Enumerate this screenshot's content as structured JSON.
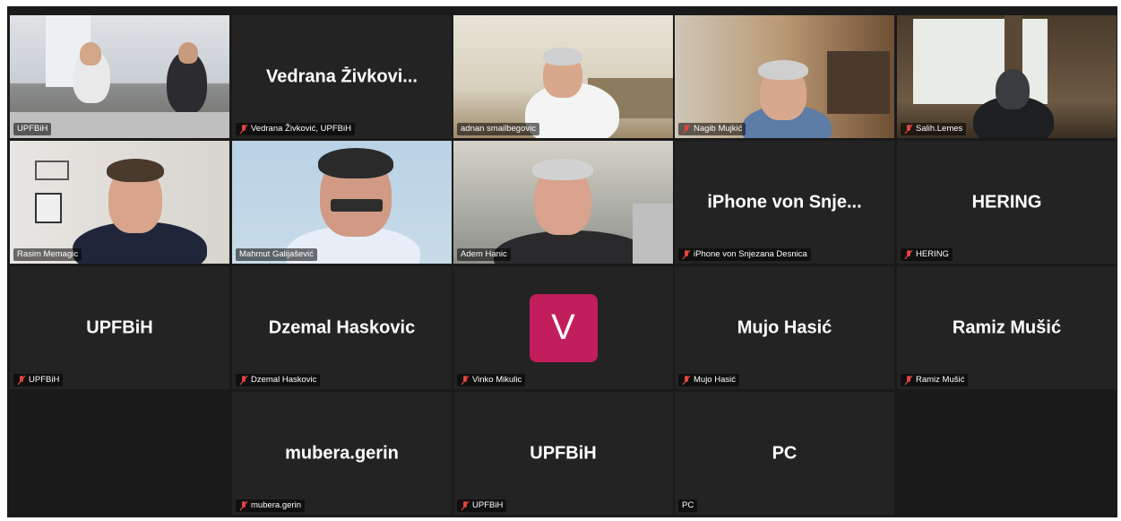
{
  "participants": [
    {
      "name": "UPFBiH",
      "muted": false,
      "video": true,
      "display_name": ""
    },
    {
      "name": "Vedrana Živković, UPFBiH",
      "muted": true,
      "video": false,
      "display_name": "Vedrana Živkovi..."
    },
    {
      "name": "adnan smailbegovic",
      "muted": false,
      "video": true,
      "display_name": ""
    },
    {
      "name": "Nagib Mujkić",
      "muted": true,
      "video": true,
      "display_name": ""
    },
    {
      "name": "Salih.Lemes",
      "muted": true,
      "video": true,
      "display_name": ""
    },
    {
      "name": "Rasim Memagic",
      "muted": false,
      "video": true,
      "display_name": "",
      "speaking": true
    },
    {
      "name": "Mahmut Galijašević",
      "muted": false,
      "video": true,
      "display_name": ""
    },
    {
      "name": "Adem Hanic",
      "muted": false,
      "video": true,
      "display_name": ""
    },
    {
      "name": "iPhone von Snjezana Desnica",
      "muted": true,
      "video": false,
      "display_name": "iPhone von Snje..."
    },
    {
      "name": "HERING",
      "muted": true,
      "video": false,
      "display_name": "HERING"
    },
    {
      "name": "UPFBiH",
      "muted": true,
      "video": false,
      "display_name": "UPFBiH"
    },
    {
      "name": "Dzemal Haskovic",
      "muted": true,
      "video": false,
      "display_name": "Dzemal Haskovic"
    },
    {
      "name": "Vinko Mikulic",
      "muted": true,
      "video": false,
      "display_name": "",
      "avatar": "V"
    },
    {
      "name": "Mujo Hasić",
      "muted": true,
      "video": false,
      "display_name": "Mujo Hasić"
    },
    {
      "name": "Ramiz Mušić",
      "muted": true,
      "video": false,
      "display_name": "Ramiz Mušić"
    },
    {
      "name": "mubera.gerin",
      "muted": true,
      "video": false,
      "display_name": "mubera.gerin"
    },
    {
      "name": "UPFBiH",
      "muted": true,
      "video": false,
      "display_name": "UPFBiH"
    },
    {
      "name": "PC",
      "muted": false,
      "video": false,
      "display_name": "PC"
    }
  ],
  "colors": {
    "background": "#1a1a1a",
    "tile": "#232323",
    "speaking_border": "#23d96e",
    "mute_icon": "#e0443c",
    "avatar_bg": "#c11e5b"
  }
}
